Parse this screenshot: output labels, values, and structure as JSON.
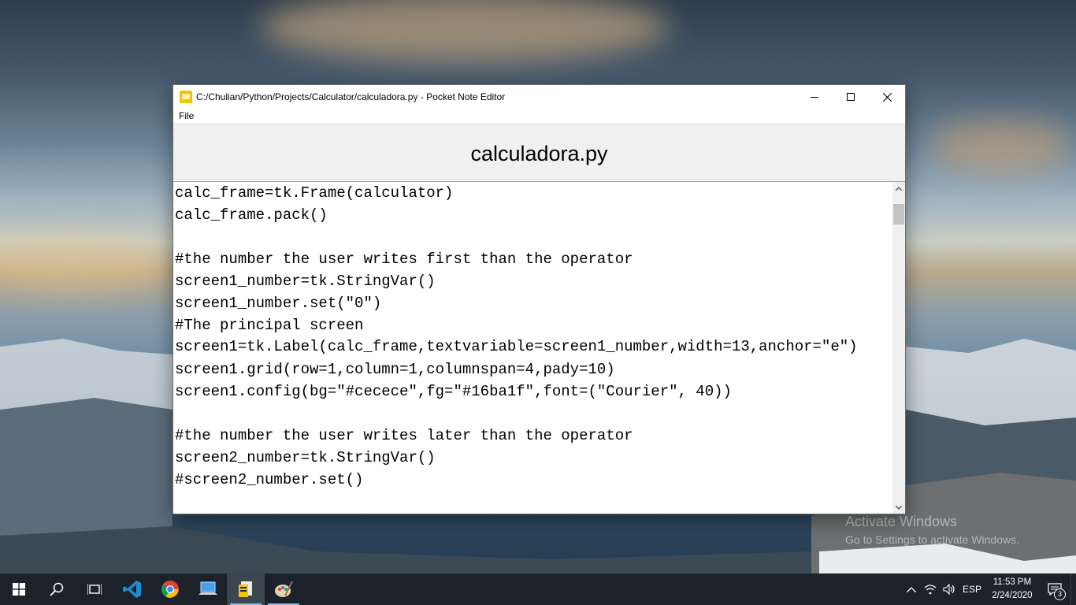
{
  "window": {
    "title": "C:/Chulian/Python/Projects/Calculator/calculadora.py - Pocket Note Editor",
    "menu": [
      "File"
    ],
    "file_title": "calculadora.py",
    "controls": [
      "minimize-icon",
      "maximize-icon",
      "close-icon"
    ]
  },
  "editor": {
    "lines": [
      "calc_frame=tk.Frame(calculator)",
      "calc_frame.pack()",
      "",
      "#the number the user writes first than the operator",
      "screen1_number=tk.StringVar()",
      "screen1_number.set(\"0\")",
      "#The principal screen",
      "screen1=tk.Label(calc_frame,textvariable=screen1_number,width=13,anchor=\"e\")",
      "screen1.grid(row=1,column=1,columnspan=4,pady=10)",
      "screen1.config(bg=\"#cecece\",fg=\"#16ba1f\",font=(\"Courier\", 40))",
      "",
      "#the number the user writes later than the operator",
      "screen2_number=tk.StringVar()",
      "#screen2_number.set()"
    ]
  },
  "desktop": {
    "watermark_line1": "Activate Windows",
    "watermark_line2": "Go to Settings to activate Windows."
  },
  "taskbar": {
    "apps": [
      "start-icon",
      "search-icon",
      "task-view-icon",
      "vscode-icon",
      "chrome-icon",
      "pc-icon",
      "pocket-note-editor-icon",
      "paint-icon"
    ],
    "language": "ESP",
    "time": "11:53 PM",
    "date": "2/24/2020",
    "notifications_count": "3"
  },
  "colors": {
    "taskbar": "#1b2229",
    "header_bg": "#f0f0f0",
    "accent": "#8db8e6"
  }
}
